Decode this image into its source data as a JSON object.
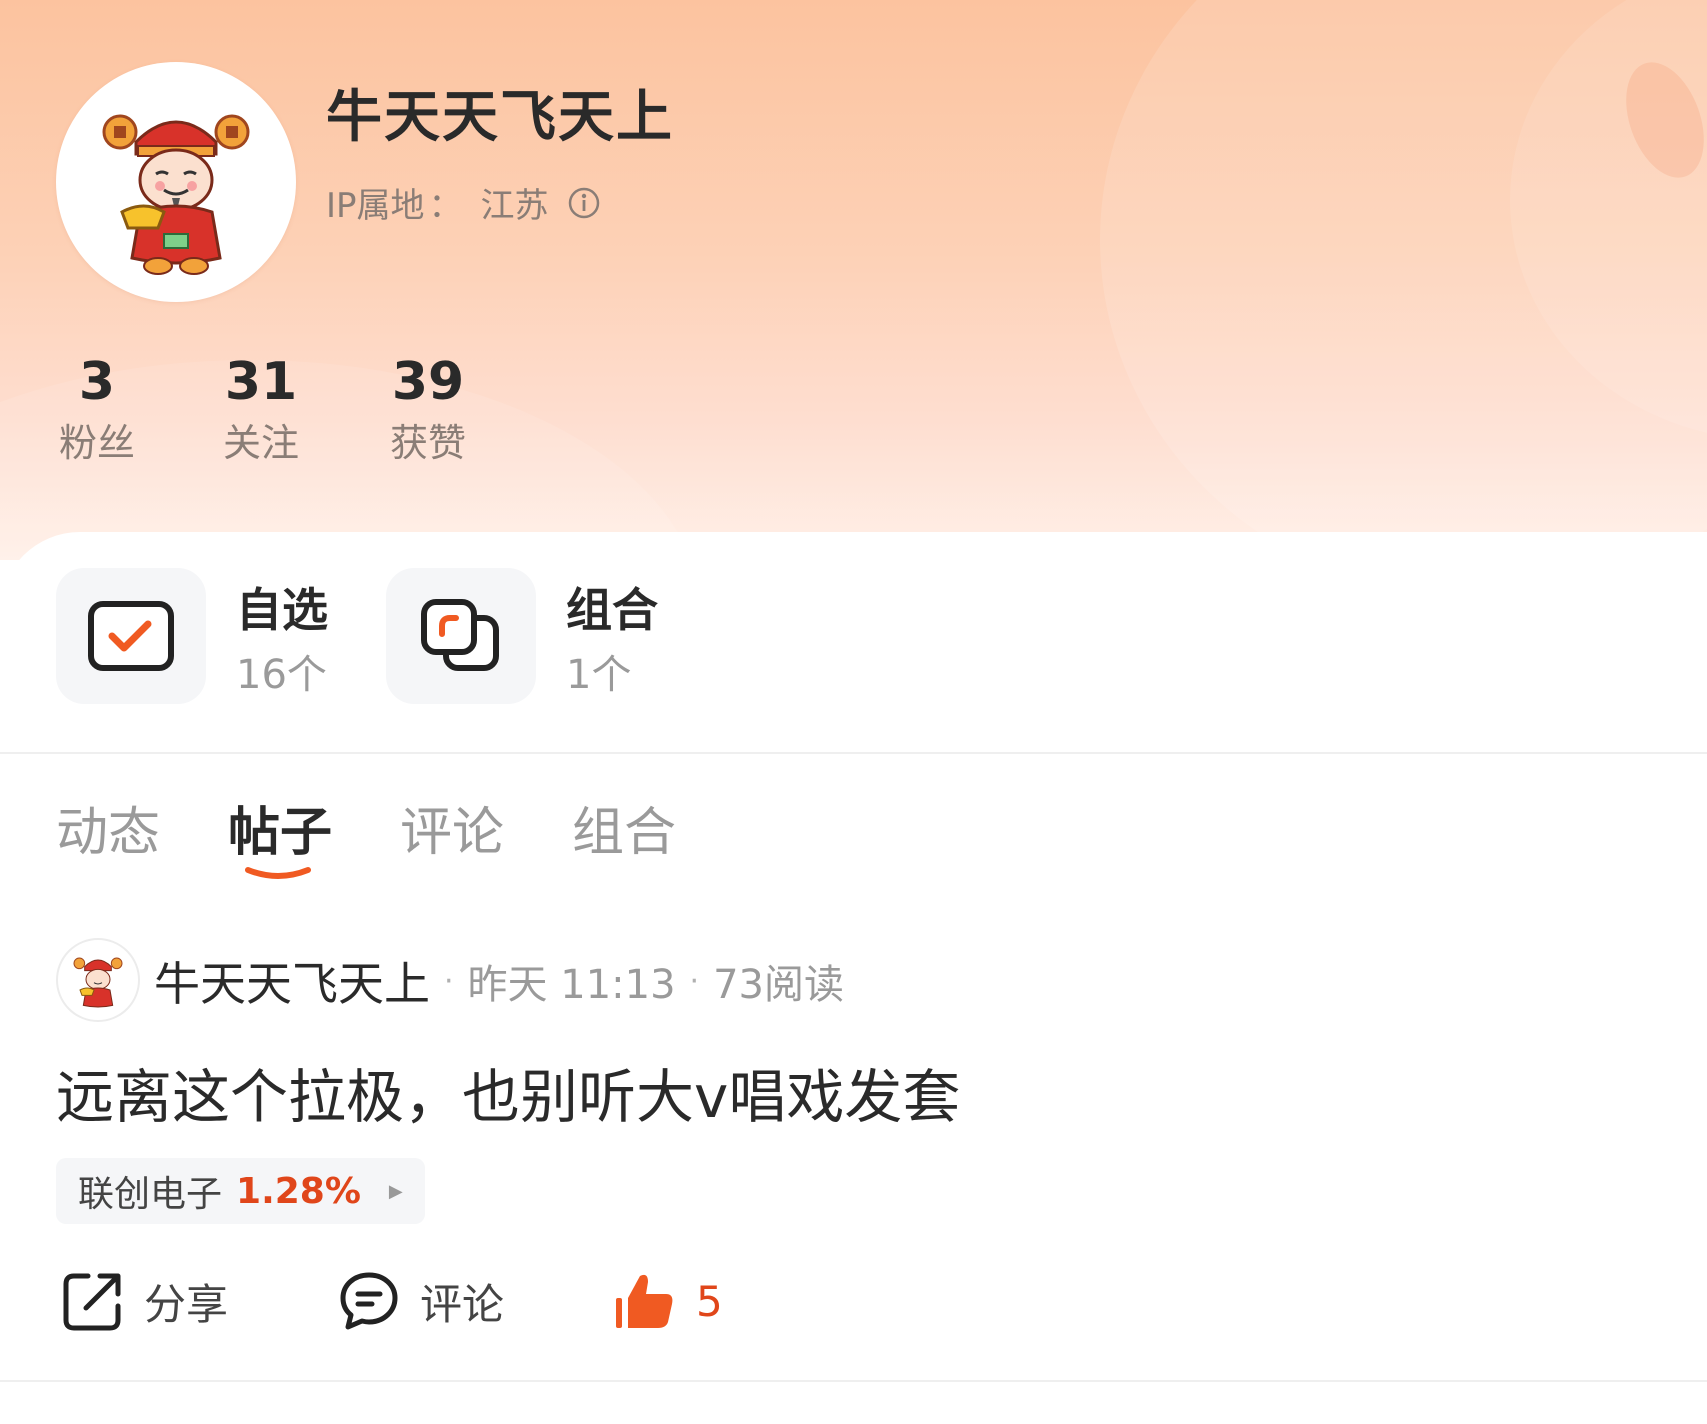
{
  "profile": {
    "username": "牛天天飞天上",
    "ip_label": "IP属地",
    "ip_sep": "：",
    "ip_value": "江苏"
  },
  "stats": [
    {
      "value": "3",
      "label": "粉丝"
    },
    {
      "value": "31",
      "label": "关注"
    },
    {
      "value": "39",
      "label": "获赞"
    }
  ],
  "shortcuts": [
    {
      "title": "自选",
      "count": "16个",
      "icon": "checkbox-icon"
    },
    {
      "title": "组合",
      "count": "1个",
      "icon": "stacked-squares-icon"
    }
  ],
  "tabs": [
    {
      "label": "动态",
      "active": false
    },
    {
      "label": "帖子",
      "active": true
    },
    {
      "label": "评论",
      "active": false
    },
    {
      "label": "组合",
      "active": false
    }
  ],
  "post": {
    "author": "牛天天飞天上",
    "time": "昨天 11:13",
    "reads": "73阅读",
    "text": "远离这个拉极，也别听大v唱戏发套",
    "stock": {
      "name": "联创电子",
      "change": "1.28%"
    },
    "actions": {
      "share_label": "分享",
      "comment_label": "评论",
      "like_count": "5"
    }
  },
  "colors": {
    "accent": "#f05a22",
    "header_top": "#fcc39f",
    "rise_red": "#e0461a"
  }
}
